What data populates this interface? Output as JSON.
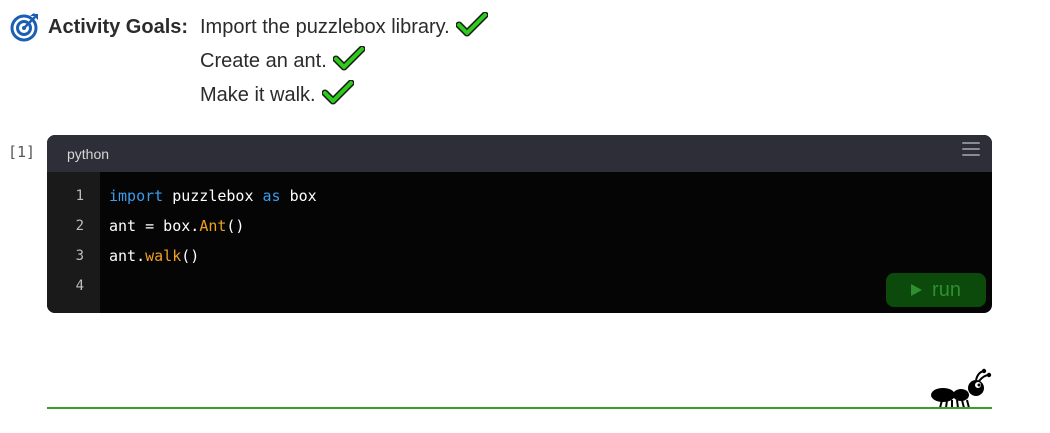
{
  "goals": {
    "label": "Activity Goals:",
    "items": [
      {
        "text": "Import the puzzlebox library.",
        "completed": true
      },
      {
        "text": "Create an ant.",
        "completed": true
      },
      {
        "text": "Make it walk.",
        "completed": true
      }
    ],
    "icon": "target-icon",
    "check_icon": "checkmark-icon",
    "check_color": "#2ecc1a",
    "icon_color": "#1a5fb4"
  },
  "cell": {
    "prompt": "[1]",
    "language": "python",
    "menu_icon": "hamburger-menu-icon",
    "line_numbers": [
      "1",
      "2",
      "3",
      "4"
    ],
    "code": {
      "line1": {
        "kw1": "import",
        "mod": " puzzlebox ",
        "kw2": "as",
        "alias": " box"
      },
      "line2": {
        "lhs": "ant = box.",
        "fn": "Ant",
        "rhs": "()"
      },
      "line3": {
        "obj": "ant.",
        "fn": "walk",
        "rhs": "()"
      },
      "line4": ""
    },
    "run_label": "run",
    "run_icon": "play-icon",
    "colors": {
      "keyword": "#3d9be9",
      "function": "#f0a020",
      "run_bg": "#0c4a0c"
    }
  },
  "output": {
    "sprite": "ant-icon",
    "ground_color": "#3a9a2a"
  }
}
